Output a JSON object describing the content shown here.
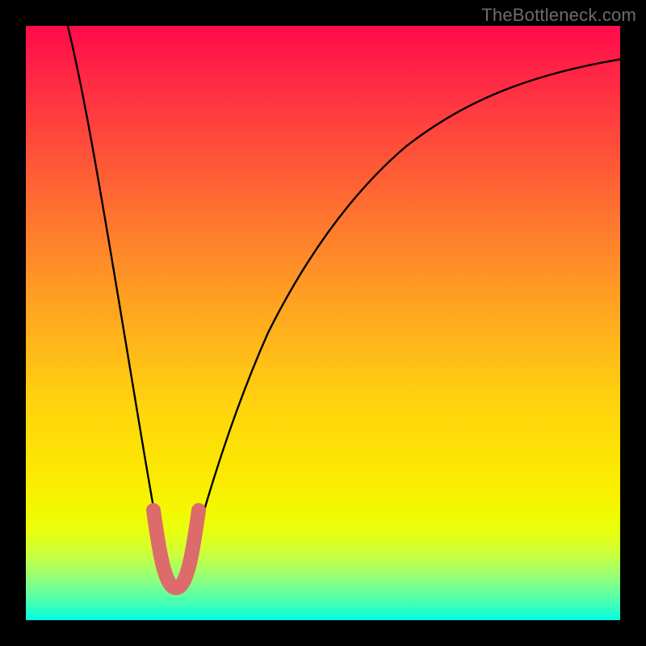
{
  "watermark": {
    "text": "TheBottleneck.com"
  },
  "chart_data": {
    "type": "line",
    "title": "",
    "xlabel": "",
    "ylabel": "",
    "xlim": [
      0,
      100
    ],
    "ylim": [
      0,
      100
    ],
    "grid": false,
    "series": [
      {
        "name": "bottleneck-curve",
        "color": "#000000",
        "x": [
          6,
          8,
          10,
          12,
          14,
          16,
          18,
          20,
          21,
          22,
          23,
          24,
          25,
          26,
          27,
          28,
          30,
          32,
          34,
          36,
          38,
          40,
          44,
          48,
          52,
          56,
          60,
          64,
          68,
          72,
          76,
          80,
          84,
          88,
          92,
          96,
          100
        ],
        "values": [
          100,
          91,
          82,
          73,
          64,
          55,
          46,
          37,
          30,
          22,
          13,
          8,
          6,
          6,
          8,
          13,
          24,
          33,
          40,
          46,
          51,
          55,
          61,
          66,
          70,
          73.5,
          76.5,
          79,
          81,
          82.8,
          84.4,
          85.8,
          87,
          88,
          88.9,
          89.7,
          90.5
        ]
      },
      {
        "name": "highlight-segment",
        "color": "#e06a6a",
        "x_range": [
          21,
          29
        ],
        "note": "thick rounded stroke over the valley"
      }
    ],
    "valley_x": 25,
    "valley_y": 6,
    "background": "red-yellow-green vertical gradient"
  }
}
